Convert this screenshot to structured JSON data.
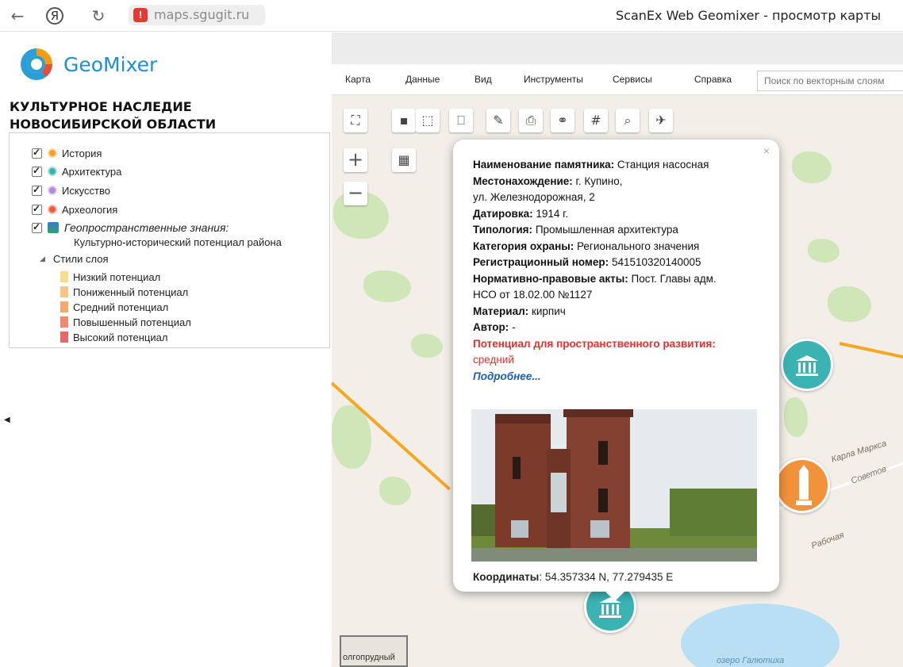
{
  "browser": {
    "back_icon": "←",
    "yandex_icon": "Я",
    "reload_icon": "↻",
    "warning_icon": "!",
    "url": "maps.sgugit.ru",
    "page_title": "ScanEx Web Geomixer - просмотр карты"
  },
  "sidebar": {
    "logo_text": "GeoMixer",
    "map_title": "КУЛЬТУРНОЕ НАСЛЕДИЕ НОВОСИБИРСКОЙ ОБЛАСТИ",
    "layers": [
      {
        "label": "История",
        "color": "#f5a02a"
      },
      {
        "label": "Архитектура",
        "color": "#35b3b0"
      },
      {
        "label": "Искусство",
        "color": "#b28ad6"
      },
      {
        "label": "Археология",
        "color": "#ee5a3a"
      }
    ],
    "geo_layer_title": "Геопространственные знания:",
    "geo_layer_sub": "Культурно-исторический потенциал района",
    "styles_label": "Стили слоя",
    "styles": [
      {
        "label": "Низкий потенциал",
        "color": "#fbdc8c"
      },
      {
        "label": "Пониженный потенциал",
        "color": "#f9c586"
      },
      {
        "label": "Средний потенциал",
        "color": "#f4a96f"
      },
      {
        "label": "Повышенный потенциал",
        "color": "#ef8a6e"
      },
      {
        "label": "Высокий потенциал",
        "color": "#e86767"
      }
    ]
  },
  "menu": {
    "items": [
      "Карта",
      "Данные",
      "Вид",
      "Инструменты",
      "Сервисы",
      "Справка"
    ],
    "search_placeholder": "Поиск по векторным слоям"
  },
  "map": {
    "streets": [
      "Карла Маркса",
      "Советов",
      "Рабочая"
    ],
    "lake_label": "озеро Галютиха",
    "minimap_label": "олгопрудный"
  },
  "popup": {
    "close_icon": "×",
    "name_label": "Наименование памятника:",
    "name_value": "Станция насосная",
    "location_label": "Местонахождение:",
    "location_value_1": "г. Купино,",
    "location_value_2": "ул. Железнодорожная, 2",
    "dating_label": "Датировка:",
    "dating_value": "1914 г.",
    "typology_label": "Типология:",
    "typology_value": "Промышленная архитектура",
    "category_label": "Категория охраны:",
    "category_value": "Регионального значения",
    "regnum_label": "Регистрационный номер:",
    "regnum_value": "541510320140005",
    "acts_label": "Нормативно-правовые акты:",
    "acts_value_1": "Пост. Главы адм.",
    "acts_value_2": "НСО от 18.02.00 №1127",
    "material_label": "Материал:",
    "material_value": "кирпич",
    "author_label": "Автор:",
    "author_value": "-",
    "potential_label": "Потенциал для пространственного развития:",
    "potential_value": "средний",
    "more_link": "Подробнее...",
    "coords_label": "Координаты",
    "coords_value": ": 54.357334 N, 77.279435 E"
  }
}
